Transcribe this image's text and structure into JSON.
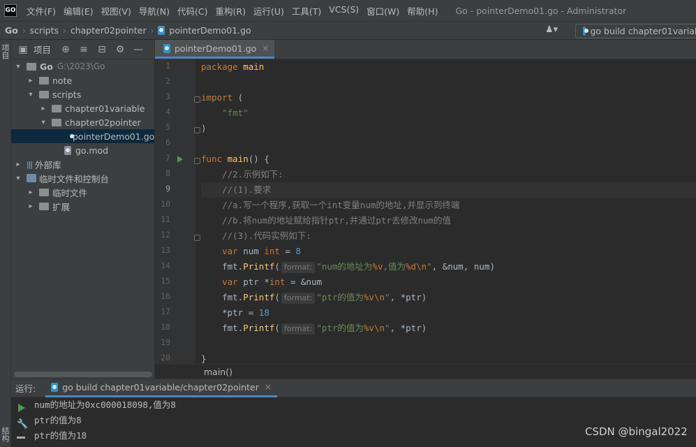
{
  "app": {
    "logo_text": "GO",
    "window_title": "Go - pointerDemo01.go - Administrator"
  },
  "menu": [
    "文件(F)",
    "编辑(E)",
    "视图(V)",
    "导航(N)",
    "代码(C)",
    "重构(R)",
    "运行(U)",
    "工具(T)",
    "VCS(S)",
    "窗口(W)",
    "帮助(H)"
  ],
  "navbar": {
    "crumbs": [
      "Go",
      "scripts",
      "chapter02pointer",
      "pointerDemo01.go"
    ],
    "run_config": "go build chapter01variab"
  },
  "sidebar_tabs": {
    "project": "项目",
    "structure": "结构"
  },
  "project_panel": {
    "title": "项目",
    "tree": [
      {
        "label": "Go",
        "hint": "G:\\2023\\Go",
        "arrow": "▾",
        "bold": true
      },
      {
        "label": "note",
        "arrow": "▸"
      },
      {
        "label": "scripts",
        "arrow": "▾"
      },
      {
        "label": "chapter01variable",
        "arrow": "▸"
      },
      {
        "label": "chapter02pointer",
        "arrow": "▾"
      },
      {
        "label": "pointerDemo01.go",
        "selected": true
      },
      {
        "label": "go.mod"
      },
      {
        "label": "外部库",
        "arrow": "▸"
      },
      {
        "label": "临时文件和控制台",
        "arrow": "▾"
      },
      {
        "label": "临时文件",
        "arrow": "▸"
      },
      {
        "label": "扩展",
        "arrow": "▸"
      }
    ]
  },
  "editor": {
    "tab_label": "pointerDemo01.go",
    "current_line": 9,
    "line_numbers": [
      "1",
      "2",
      "3",
      "4",
      "5",
      "6",
      "7",
      "8",
      "9",
      "10",
      "11",
      "12",
      "13",
      "14",
      "15",
      "16",
      "17",
      "18",
      "19",
      "20"
    ],
    "lines": [
      [
        {
          "t": "package",
          "c": "kw"
        },
        {
          "t": " main",
          "c": "fn"
        }
      ],
      [],
      [
        {
          "t": "import",
          "c": "kw"
        },
        {
          "t": " (",
          "c": ""
        }
      ],
      [
        {
          "t": "    \"fmt\"",
          "c": "str"
        }
      ],
      [
        {
          "t": ")",
          "c": ""
        }
      ],
      [],
      [
        {
          "t": "func",
          "c": "kw"
        },
        {
          "t": " ",
          "c": ""
        },
        {
          "t": "main",
          "c": "fn"
        },
        {
          "t": "() {",
          "c": ""
        }
      ],
      [
        {
          "t": "    //2.示例如下:",
          "c": "cmt"
        }
      ],
      [
        {
          "t": "    //(1).要求",
          "c": "cmt"
        }
      ],
      [
        {
          "t": "    //a.写一个程序,获取一个int变量num的地址,并显示到终端",
          "c": "cmt"
        }
      ],
      [
        {
          "t": "    //b.将num的地址赋给指针ptr,并通过ptr去修改num的值",
          "c": "cmt"
        }
      ],
      [
        {
          "t": "    //(3).代码实例如下:",
          "c": "cmt"
        }
      ],
      [
        {
          "t": "    ",
          "c": ""
        },
        {
          "t": "var",
          "c": "kw"
        },
        {
          "t": " num ",
          "c": ""
        },
        {
          "t": "int",
          "c": "kw"
        },
        {
          "t": " = ",
          "c": ""
        },
        {
          "t": "8",
          "c": "num"
        }
      ],
      [
        {
          "t": "    fmt.",
          "c": ""
        },
        {
          "t": "Printf",
          "c": "fn"
        },
        {
          "t": "(",
          "c": ""
        },
        {
          "t": "format:",
          "c": "hint"
        },
        {
          "t": "\"num的地址为",
          "c": "str"
        },
        {
          "t": "%v",
          "c": "fmtv"
        },
        {
          "t": ",值为",
          "c": "str"
        },
        {
          "t": "%d\\n",
          "c": "fmtv"
        },
        {
          "t": "\"",
          "c": "str"
        },
        {
          "t": ", &num, num)",
          "c": ""
        }
      ],
      [
        {
          "t": "    ",
          "c": ""
        },
        {
          "t": "var",
          "c": "kw"
        },
        {
          "t": " ptr *",
          "c": ""
        },
        {
          "t": "int",
          "c": "kw"
        },
        {
          "t": " = &num",
          "c": ""
        }
      ],
      [
        {
          "t": "    fmt.",
          "c": ""
        },
        {
          "t": "Printf",
          "c": "fn"
        },
        {
          "t": "(",
          "c": ""
        },
        {
          "t": "format:",
          "c": "hint"
        },
        {
          "t": "\"ptr的值为",
          "c": "str"
        },
        {
          "t": "%v\\n",
          "c": "fmtv"
        },
        {
          "t": "\"",
          "c": "str"
        },
        {
          "t": ", *ptr)",
          "c": ""
        }
      ],
      [
        {
          "t": "    *ptr = ",
          "c": ""
        },
        {
          "t": "18",
          "c": "num"
        }
      ],
      [
        {
          "t": "    fmt.",
          "c": ""
        },
        {
          "t": "Printf",
          "c": "fn"
        },
        {
          "t": "(",
          "c": ""
        },
        {
          "t": "format:",
          "c": "hint"
        },
        {
          "t": "\"ptr的值为",
          "c": "str"
        },
        {
          "t": "%v\\n",
          "c": "fmtv"
        },
        {
          "t": "\"",
          "c": "str"
        },
        {
          "t": ", *ptr)",
          "c": ""
        }
      ],
      [],
      [
        {
          "t": "}",
          "c": ""
        }
      ]
    ],
    "breadcrumb": "main()"
  },
  "run_panel": {
    "label": "运行:",
    "tab_label": "go build chapter01variable/chapter02pointer",
    "output": [
      "num的地址为0xc000018098,值为8",
      "ptr的值为8",
      "ptr的值为18"
    ]
  },
  "watermark": "CSDN @bingal2022"
}
